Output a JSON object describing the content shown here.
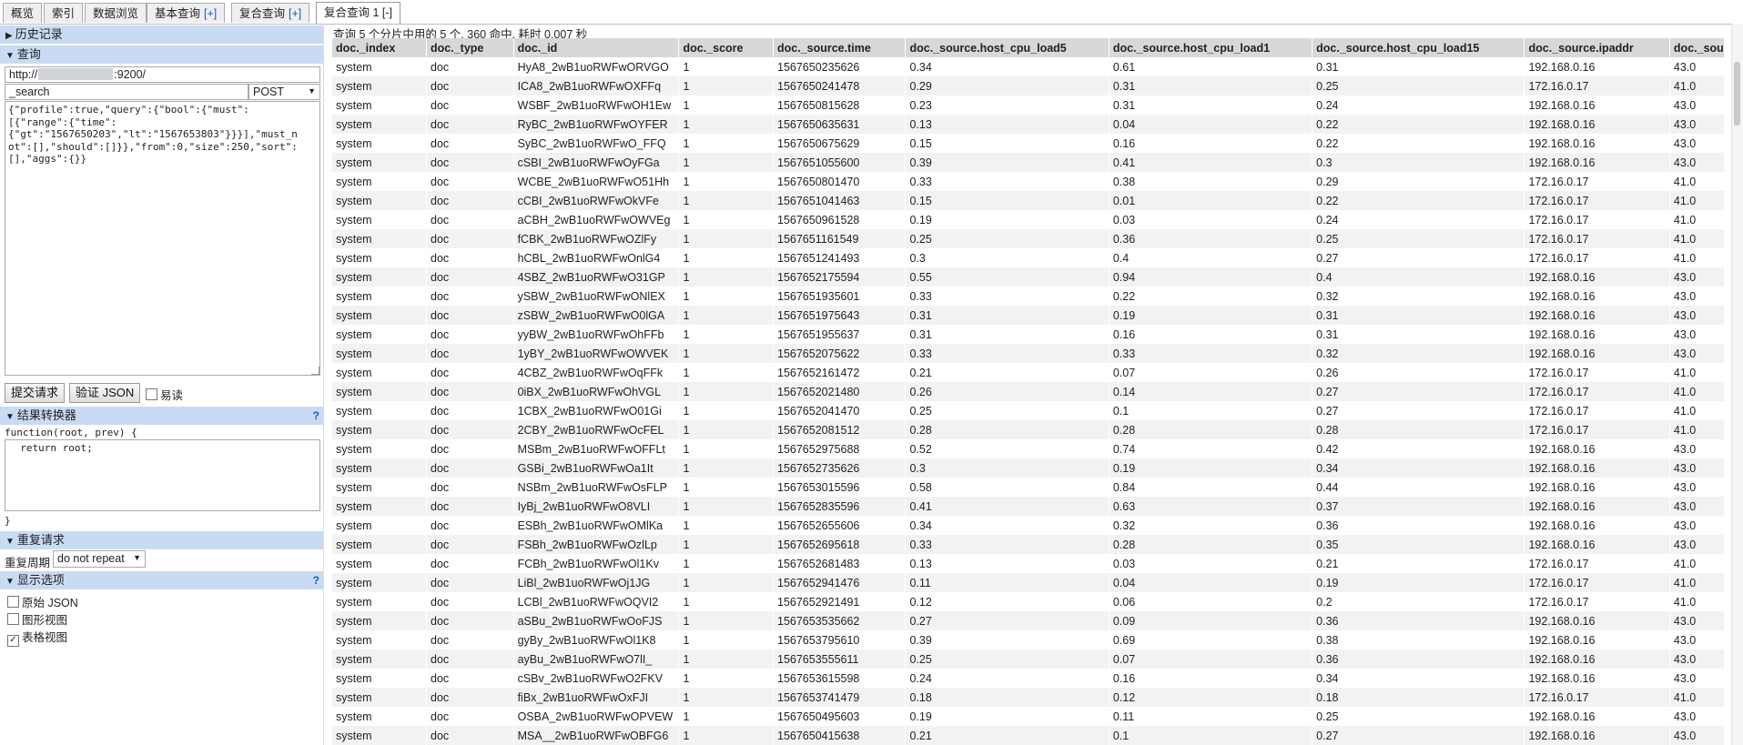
{
  "tabs": [
    {
      "label": "概览",
      "plus": ""
    },
    {
      "label": "索引",
      "plus": ""
    },
    {
      "label": "数据浏览",
      "plus": ""
    },
    {
      "label": "基本查询",
      "plus": "[+]"
    },
    {
      "label": "复合查询",
      "plus": "[+]"
    },
    {
      "label": "复合查询 1",
      "plus": "[-]"
    }
  ],
  "left": {
    "history_label": "历史记录",
    "query_label": "查询",
    "url_prefix": "http://",
    "url_suffix": ":9200/",
    "path_value": "_search",
    "method_value": "POST",
    "query_body": "{\"profile\":true,\"query\":{\"bool\":{\"must\":\n[{\"range\":{\"time\":\n{\"gt\":\"1567650203\",\"lt\":\"1567653803\"}}}],\"must_n\not\":[],\"should\":[]}},\"from\":0,\"size\":250,\"sort\":\n[],\"aggs\":{}}",
    "submit_label": "提交请求",
    "validate_label": "验证 JSON",
    "easy_read_label": "易读",
    "transform_label": "结果转换器",
    "transform_help": "?",
    "transform_sig": "function(root, prev) {",
    "transform_body": "  return root;",
    "transform_close": "}",
    "repeat_label": "重复请求",
    "repeat_period_label": "重复周期",
    "repeat_period_value": "do not repeat",
    "display_label": "显示选项",
    "display_help": "?",
    "opt_raw_json": "原始 JSON",
    "opt_graph": "图形视图",
    "opt_table": "表格视图",
    "opt_raw_checked": false,
    "opt_graph_checked": false,
    "opt_table_checked": true
  },
  "summary": "查询 5 个分片中用的 5 个. 360 命中. 耗时 0.007 秒",
  "columns": [
    "doc._index",
    "doc._type",
    "doc._id",
    "doc._score",
    "doc._source.time",
    "doc._source.host_cpu_load5",
    "doc._source.host_cpu_load1",
    "doc._source.host_cpu_load15",
    "doc._source.ipaddr",
    "doc._sou"
  ],
  "rows": [
    [
      "system",
      "doc",
      "HyA8_2wB1uoRWFwORVGO",
      "1",
      "1567650235626",
      "0.34",
      "0.61",
      "0.31",
      "192.168.0.16",
      "43.0"
    ],
    [
      "system",
      "doc",
      "ICA8_2wB1uoRWFwOXFFq",
      "1",
      "1567650241478",
      "0.29",
      "0.31",
      "0.25",
      "172.16.0.17",
      "41.0"
    ],
    [
      "system",
      "doc",
      "WSBF_2wB1uoRWFwOH1Ew",
      "1",
      "1567650815628",
      "0.23",
      "0.31",
      "0.24",
      "192.168.0.16",
      "43.0"
    ],
    [
      "system",
      "doc",
      "RyBC_2wB1uoRWFwOYFER",
      "1",
      "1567650635631",
      "0.13",
      "0.04",
      "0.22",
      "192.168.0.16",
      "43.0"
    ],
    [
      "system",
      "doc",
      "SyBC_2wB1uoRWFwO_FFQ",
      "1",
      "1567650675629",
      "0.15",
      "0.16",
      "0.22",
      "192.168.0.16",
      "43.0"
    ],
    [
      "system",
      "doc",
      "cSBI_2wB1uoRWFwOyFGa",
      "1",
      "1567651055600",
      "0.39",
      "0.41",
      "0.3",
      "192.168.0.16",
      "43.0"
    ],
    [
      "system",
      "doc",
      "WCBE_2wB1uoRWFwO51Hh",
      "1",
      "1567650801470",
      "0.33",
      "0.38",
      "0.29",
      "172.16.0.17",
      "41.0"
    ],
    [
      "system",
      "doc",
      "cCBI_2wB1uoRWFwOkVFe",
      "1",
      "1567651041463",
      "0.15",
      "0.01",
      "0.22",
      "172.16.0.17",
      "41.0"
    ],
    [
      "system",
      "doc",
      "aCBH_2wB1uoRWFwOWVEg",
      "1",
      "1567650961528",
      "0.19",
      "0.03",
      "0.24",
      "172.16.0.17",
      "41.0"
    ],
    [
      "system",
      "doc",
      "fCBK_2wB1uoRWFwOZlFy",
      "1",
      "1567651161549",
      "0.25",
      "0.36",
      "0.25",
      "172.16.0.17",
      "41.0"
    ],
    [
      "system",
      "doc",
      "hCBL_2wB1uoRWFwOnlG4",
      "1",
      "1567651241493",
      "0.3",
      "0.4",
      "0.27",
      "172.16.0.17",
      "41.0"
    ],
    [
      "system",
      "doc",
      "4SBZ_2wB1uoRWFwO31GP",
      "1",
      "1567652175594",
      "0.55",
      "0.94",
      "0.4",
      "192.168.0.16",
      "43.0"
    ],
    [
      "system",
      "doc",
      "ySBW_2wB1uoRWFwONlEX",
      "1",
      "1567651935601",
      "0.33",
      "0.22",
      "0.32",
      "192.168.0.16",
      "43.0"
    ],
    [
      "system",
      "doc",
      "zSBW_2wB1uoRWFwO0lGA",
      "1",
      "1567651975643",
      "0.31",
      "0.19",
      "0.31",
      "192.168.0.16",
      "43.0"
    ],
    [
      "system",
      "doc",
      "yyBW_2wB1uoRWFwOhFFb",
      "1",
      "1567651955637",
      "0.31",
      "0.16",
      "0.31",
      "192.168.0.16",
      "43.0"
    ],
    [
      "system",
      "doc",
      "1yBY_2wB1uoRWFwOWVEK",
      "1",
      "1567652075622",
      "0.33",
      "0.33",
      "0.32",
      "192.168.0.16",
      "43.0"
    ],
    [
      "system",
      "doc",
      "4CBZ_2wB1uoRWFwOqFFk",
      "1",
      "1567652161472",
      "0.21",
      "0.07",
      "0.26",
      "172.16.0.17",
      "41.0"
    ],
    [
      "system",
      "doc",
      "0iBX_2wB1uoRWFwOhVGL",
      "1",
      "1567652021480",
      "0.26",
      "0.14",
      "0.27",
      "172.16.0.17",
      "41.0"
    ],
    [
      "system",
      "doc",
      "1CBX_2wB1uoRWFwO01Gi",
      "1",
      "1567652041470",
      "0.25",
      "0.1",
      "0.27",
      "172.16.0.17",
      "41.0"
    ],
    [
      "system",
      "doc",
      "2CBY_2wB1uoRWFwOcFEL",
      "1",
      "1567652081512",
      "0.28",
      "0.28",
      "0.28",
      "172.16.0.17",
      "41.0"
    ],
    [
      "system",
      "doc",
      "MSBm_2wB1uoRWFwOFFLt",
      "1",
      "1567652975688",
      "0.52",
      "0.74",
      "0.42",
      "192.168.0.16",
      "43.0"
    ],
    [
      "system",
      "doc",
      "GSBi_2wB1uoRWFwOa1It",
      "1",
      "1567652735626",
      "0.3",
      "0.19",
      "0.34",
      "192.168.0.16",
      "43.0"
    ],
    [
      "system",
      "doc",
      "NSBm_2wB1uoRWFwOsFLP",
      "1",
      "1567653015596",
      "0.58",
      "0.84",
      "0.44",
      "192.168.0.16",
      "43.0"
    ],
    [
      "system",
      "doc",
      "IyBj_2wB1uoRWFwO8VLI",
      "1",
      "1567652835596",
      "0.41",
      "0.63",
      "0.37",
      "192.168.0.16",
      "43.0"
    ],
    [
      "system",
      "doc",
      "ESBh_2wB1uoRWFwOMlKa",
      "1",
      "1567652655606",
      "0.34",
      "0.32",
      "0.36",
      "192.168.0.16",
      "43.0"
    ],
    [
      "system",
      "doc",
      "FSBh_2wB1uoRWFwOzlLp",
      "1",
      "1567652695618",
      "0.33",
      "0.28",
      "0.35",
      "192.168.0.16",
      "43.0"
    ],
    [
      "system",
      "doc",
      "FCBh_2wB1uoRWFwOl1Kv",
      "1",
      "1567652681483",
      "0.13",
      "0.03",
      "0.21",
      "172.16.0.17",
      "41.0"
    ],
    [
      "system",
      "doc",
      "LiBl_2wB1uoRWFwOj1JG",
      "1",
      "1567652941476",
      "0.11",
      "0.04",
      "0.19",
      "172.16.0.17",
      "41.0"
    ],
    [
      "system",
      "doc",
      "LCBl_2wB1uoRWFwOQVI2",
      "1",
      "1567652921491",
      "0.12",
      "0.06",
      "0.2",
      "172.16.0.17",
      "41.0"
    ],
    [
      "system",
      "doc",
      "aSBu_2wB1uoRWFwOoFJS",
      "1",
      "1567653535662",
      "0.27",
      "0.09",
      "0.36",
      "192.168.0.16",
      "43.0"
    ],
    [
      "system",
      "doc",
      "gyBy_2wB1uoRWFwOl1K8",
      "1",
      "1567653795610",
      "0.39",
      "0.69",
      "0.38",
      "192.168.0.16",
      "43.0"
    ],
    [
      "system",
      "doc",
      "ayBu_2wB1uoRWFwO7lI_",
      "1",
      "1567653555611",
      "0.25",
      "0.07",
      "0.36",
      "192.168.0.16",
      "43.0"
    ],
    [
      "system",
      "doc",
      "cSBv_2wB1uoRWFwO2FKV",
      "1",
      "1567653615598",
      "0.24",
      "0.16",
      "0.34",
      "192.168.0.16",
      "43.0"
    ],
    [
      "system",
      "doc",
      "fiBx_2wB1uoRWFwOxFJI",
      "1",
      "1567653741479",
      "0.18",
      "0.12",
      "0.18",
      "172.16.0.17",
      "41.0"
    ],
    [
      "system",
      "doc",
      "OSBA_2wB1uoRWFwOPVEW",
      "1",
      "1567650495603",
      "0.19",
      "0.11",
      "0.25",
      "192.168.0.16",
      "43.0"
    ],
    [
      "system",
      "doc",
      "MSA__2wB1uoRWFwOBFG6",
      "1",
      "1567650415638",
      "0.21",
      "0.1",
      "0.27",
      "192.168.0.16",
      "43.0"
    ]
  ]
}
